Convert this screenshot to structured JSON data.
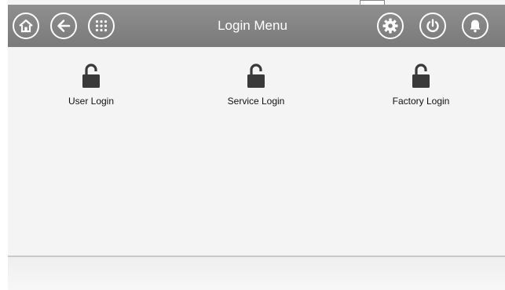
{
  "header": {
    "title": "Login Menu",
    "left_icons": [
      "home-icon",
      "back-arrow-icon",
      "grid-menu-icon"
    ],
    "right_icons": [
      "settings-gear-icon",
      "power-icon",
      "alarm-bell-icon"
    ]
  },
  "logins": [
    {
      "label": "User Login",
      "icon": "unlocked-padlock-icon"
    },
    {
      "label": "Service Login",
      "icon": "unlocked-padlock-icon"
    },
    {
      "label": "Factory Login",
      "icon": "unlocked-padlock-icon"
    }
  ],
  "colors": {
    "header_bg": "#858585",
    "icon_fg": "#ffffff",
    "content_bg": "#f4f4f4",
    "lock_color": "#3a3a3a",
    "label_color": "#111111"
  }
}
